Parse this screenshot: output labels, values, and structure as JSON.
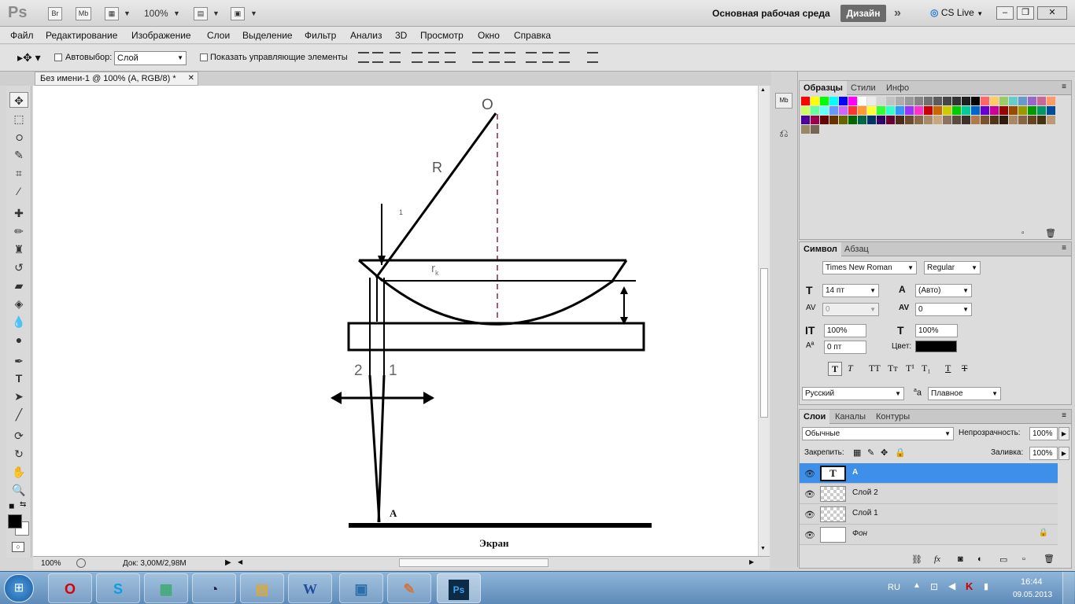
{
  "app": {
    "logo": "Ps",
    "br": "Br",
    "mb": "Mb",
    "zoom": "100%",
    "workspace": "Основная рабочая среда",
    "design": "Дизайн",
    "cslive": "CS Live"
  },
  "menu": [
    "Файл",
    "Редактирование",
    "Изображение",
    "Слои",
    "Выделение",
    "Фильтр",
    "Анализ",
    "3D",
    "Просмотр",
    "Окно",
    "Справка"
  ],
  "options": {
    "autoselect": "Автовыбор:",
    "layer_select": "Слой",
    "show_controls": "Показать управляющие элементы"
  },
  "document": {
    "tab": "Без имени-1 @ 100% (A, RGB/8) *",
    "zoom": "100%",
    "doc_size": "Док: 3,00M/2,98M"
  },
  "drawing": {
    "label_O": "O",
    "label_R": "R",
    "label_1top": "1",
    "label_rk": "r",
    "label_rk_sub": "k",
    "label_2": "2",
    "label_1": "1",
    "label_A": "A",
    "screen": "Экран"
  },
  "swatches": {
    "tabs": [
      "Образцы",
      "Стили",
      "Инфо"
    ],
    "colors": [
      "#ff0000",
      "#ffff00",
      "#00ff00",
      "#00ffff",
      "#0000ff",
      "#ff00ff",
      "#ffffff",
      "#ebebeb",
      "#d6d6d6",
      "#c2c2c2",
      "#adadad",
      "#999999",
      "#858585",
      "#707070",
      "#5c5c5c",
      "#474747",
      "#333333",
      "#1f1f1f",
      "#000000",
      "#ff6666",
      "#ffcc66",
      "#99cc66",
      "#66cccc",
      "#6699cc",
      "#9966cc",
      "#cc6699",
      "#ff9966",
      "#ccff66",
      "#66ff99",
      "#66ffff",
      "#6699ff",
      "#cc66ff",
      "#ff3333",
      "#ff9933",
      "#ffff33",
      "#33ff33",
      "#33ffcc",
      "#3399ff",
      "#9933ff",
      "#ff33cc",
      "#cc0000",
      "#cc6600",
      "#cccc00",
      "#00cc00",
      "#00cc99",
      "#0066cc",
      "#6600cc",
      "#cc0099",
      "#990000",
      "#994c00",
      "#999900",
      "#009900",
      "#009966",
      "#004c99",
      "#4c0099",
      "#99004c",
      "#660000",
      "#663300",
      "#666600",
      "#006600",
      "#006644",
      "#003366",
      "#330066",
      "#660033",
      "#4d2b1a",
      "#6b4a2e",
      "#8b6b4a",
      "#a68a6a",
      "#c7a77e",
      "#8c7360",
      "#5c4a3c",
      "#3d3028",
      "#b07a4a",
      "#7a5230",
      "#523418",
      "#2e1c0c",
      "#aa8866",
      "#886644",
      "#664422",
      "#443311",
      "#bb9977",
      "#998866",
      "#776655"
    ]
  },
  "character": {
    "tabs": [
      "Символ",
      "Абзац"
    ],
    "font": "Times New Roman",
    "style": "Regular",
    "size": "14 пт",
    "leading": "(Авто)",
    "kerning": "0",
    "tracking": "0",
    "vscale": "100%",
    "hscale": "100%",
    "baseline": "0 пт",
    "color_label": "Цвет:",
    "language": "Русский",
    "aa_label": "a",
    "aa": "Плавное"
  },
  "layers_panel": {
    "tabs": [
      "Слои",
      "Каналы",
      "Контуры"
    ],
    "blend": "Обычные",
    "opacity_label": "Непрозрачность:",
    "opacity": "100%",
    "lock_label": "Закрепить:",
    "fill_label": "Заливка:",
    "fill": "100%",
    "layers": [
      {
        "name": "A"
      },
      {
        "name": "Слой 2"
      },
      {
        "name": "Слой 1"
      },
      {
        "name": "Фон"
      }
    ]
  },
  "taskbar": {
    "lang": "RU",
    "time": "16:44",
    "date": "09.05.2013"
  }
}
